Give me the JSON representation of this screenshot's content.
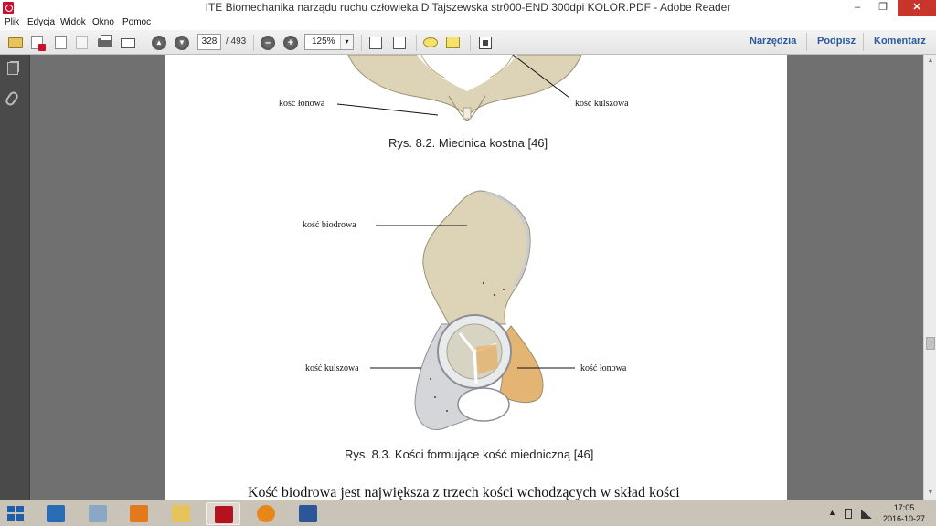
{
  "window": {
    "title": "ITE Biomechanika narządu ruchu człowieka D Tajszewska str000-END 300dpi KOLOR.PDF - Adobe Reader",
    "controls": {
      "minimize": "–",
      "maximize": "❐",
      "close": "✕"
    }
  },
  "menu": [
    "Plik",
    "Edycja",
    "Widok",
    "Okno",
    "Pomoc"
  ],
  "toolbar": {
    "current_page": "328",
    "page_total": "/ 493",
    "zoom": "125%",
    "zoom_arrow": "▾",
    "prev_arrow": "▲",
    "next_arrow": "▼",
    "zoom_out": "–",
    "zoom_in": "+",
    "icons": [
      "create-icon",
      "open-icon",
      "edit-icon",
      "save-icon",
      "print-icon",
      "email-icon",
      "previous-page-icon",
      "next-page-icon",
      "zoom-out-icon",
      "zoom-in-icon",
      "fit-page-icon",
      "fit-width-icon",
      "comment-icon",
      "highlight-icon",
      "full-screen-icon"
    ],
    "right_links": [
      "Narzędzia",
      "Podpisz",
      "Komentarz"
    ]
  },
  "document": {
    "fig1_label_left": "kość łonowa",
    "fig1_label_right": "kość kulszowa",
    "fig1_caption": "Rys. 8.2. Miednica kostna [46]",
    "fig2_label_top": "kość biodrowa",
    "fig2_label_left": "kość kulszowa",
    "fig2_label_right": "kość łonowa",
    "fig2_caption": "Rys. 8.3. Kości formujące kość miedniczną [46]",
    "body_text": "Kość biodrowa jest największa z trzech kości wchodzących w skład kości"
  },
  "taskbar": {
    "apps": [
      "start-icon",
      "network-app-icon",
      "file-explorer-icon",
      "media-player-icon",
      "folder-icon",
      "adobe-reader-icon",
      "settings-app-icon",
      "word-icon"
    ],
    "tray_arrow": "▲",
    "time": "17:05",
    "date": "2016-10-27"
  },
  "colors": {
    "doc_background": "#707070",
    "accent_link": "#2a5a9a",
    "bone_beige": "#ddd3b6",
    "bone_orange": "#e3b472",
    "close_button": "#c7352b"
  }
}
